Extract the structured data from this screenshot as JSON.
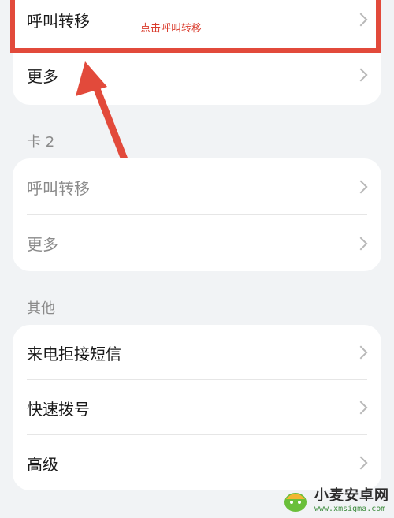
{
  "card1": {
    "items": [
      {
        "label": "呼叫转移"
      },
      {
        "label": "更多"
      }
    ]
  },
  "annotation": {
    "text": "点击呼叫转移",
    "color": "#e24a3b"
  },
  "section_card2": {
    "label": "卡 2"
  },
  "card2": {
    "items": [
      {
        "label": "呼叫转移"
      },
      {
        "label": "更多"
      }
    ]
  },
  "section_other": {
    "label": "其他"
  },
  "card3": {
    "items": [
      {
        "label": "来电拒接短信"
      },
      {
        "label": "快速拨号"
      },
      {
        "label": "高级"
      }
    ]
  },
  "watermark": {
    "title": "小麦安卓网",
    "url": "www.xmsigma.com"
  }
}
